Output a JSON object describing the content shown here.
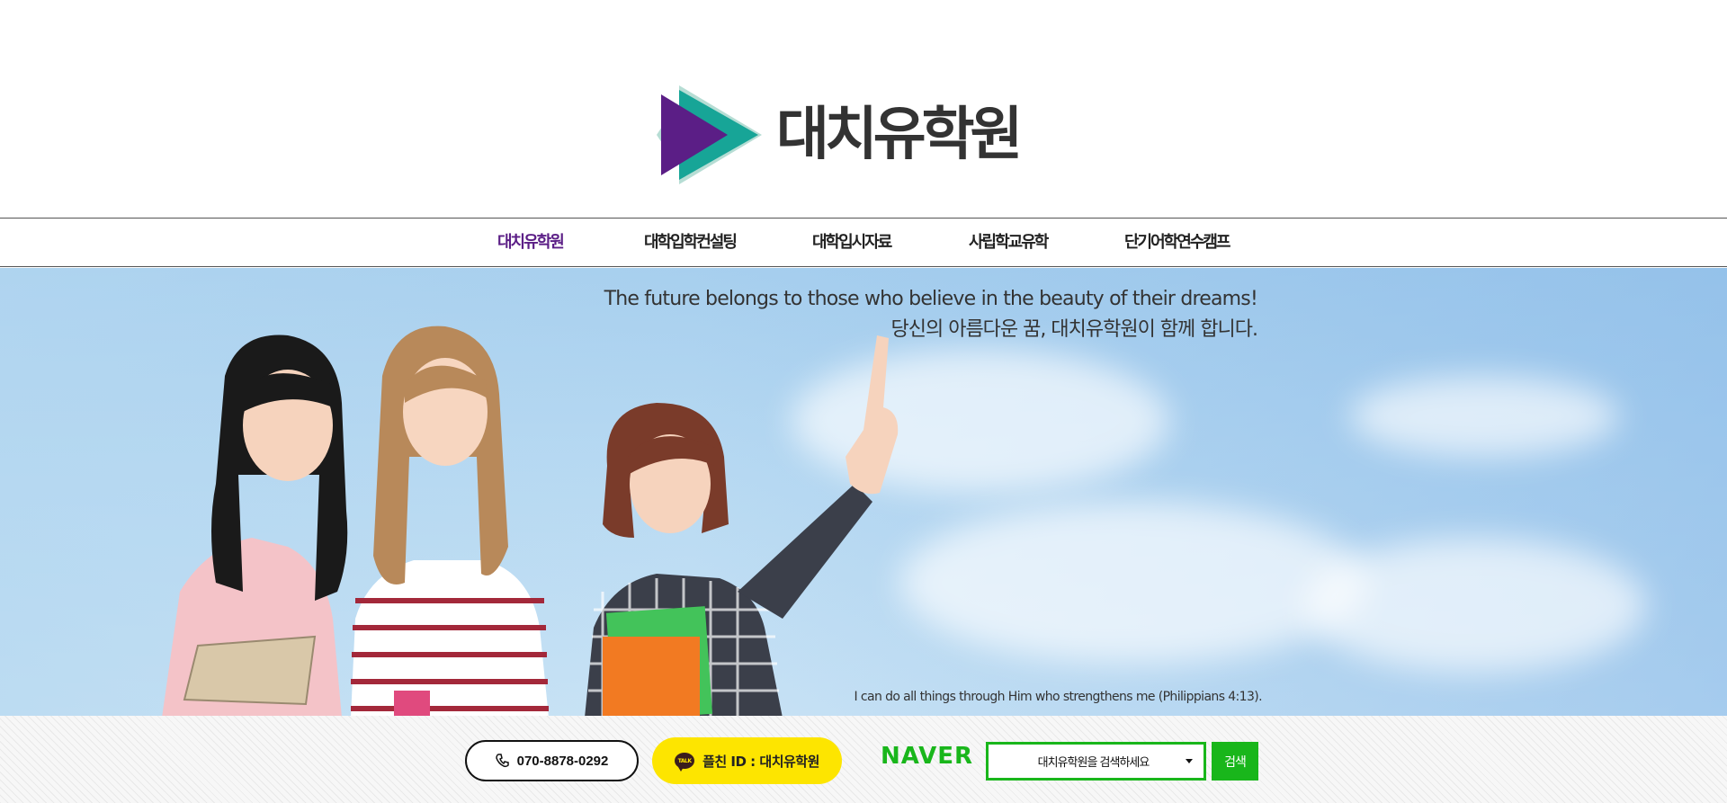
{
  "brand": {
    "name": "대치유학원",
    "colors": {
      "purple": "#5b1e86",
      "teal": "#17a597",
      "mint": "#b6ddd4"
    }
  },
  "nav": {
    "items": [
      {
        "label": "대치유학원",
        "active": true
      },
      {
        "label": "대학입학컨설팅",
        "active": false
      },
      {
        "label": "대학입시자료",
        "active": false
      },
      {
        "label": "사립학교유학",
        "active": false
      },
      {
        "label": "단기어학연수캠프",
        "active": false
      }
    ]
  },
  "hero": {
    "quote_en": "The future belongs to those who believe in the beauty of their dreams!",
    "quote_ko": "당신의 아름다운 꿈, 대치유학원이 함께 합니다.",
    "verse": "I can do all things through Him who strengthens me (Philippians 4:13)."
  },
  "footer": {
    "phone": "070-8878-0292",
    "phone_icon": "phone-icon",
    "kakao_label": "플친 ID :  대치유학원",
    "kakao_icon": "kakao-talk-icon",
    "naver_logo": "NAVER",
    "naver_select_value": "대치유학원을 검색하세요",
    "search_label": "검색",
    "naver_green": "#19b61b",
    "kakao_yellow": "#fde500"
  }
}
